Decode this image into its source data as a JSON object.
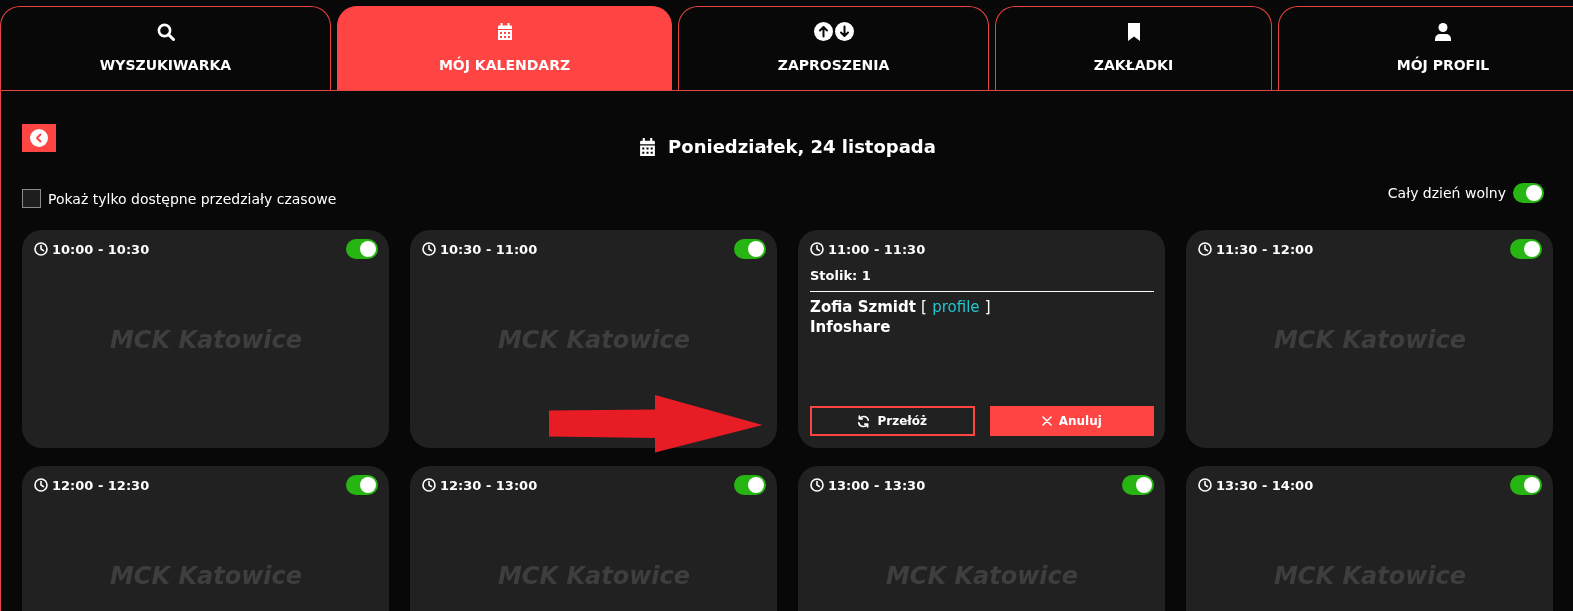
{
  "tabs": [
    {
      "label": "WYSZUKIWARKA",
      "selected": false
    },
    {
      "label": "MÓJ KALENDARZ",
      "selected": true
    },
    {
      "label": "ZAPROSZENIA",
      "selected": false
    },
    {
      "label": "ZAKŁADKI",
      "selected": false
    },
    {
      "label": "MÓJ PROFIL",
      "selected": false
    }
  ],
  "header": {
    "title": "Poniedziałek, 24 listopada"
  },
  "filter": {
    "label": "Pokaż tylko dostępne przedziały czasowe",
    "checked": false
  },
  "day_off": {
    "label": "Cały dzień wolny",
    "on": true
  },
  "slots": [
    {
      "kind": "free",
      "time": "10:00 - 10:30",
      "on": true,
      "venue": "MCK Katowice"
    },
    {
      "kind": "free",
      "time": "10:30 - 11:00",
      "on": true,
      "venue": "MCK Katowice"
    },
    {
      "kind": "booked",
      "time": "11:00 - 11:30",
      "table": "Stolik: 1",
      "guest": "Zofia Szmidt",
      "link_open": "[",
      "link": "profile",
      "link_close": "]",
      "company": "Infoshare",
      "buttons": [
        {
          "kind": "reschedule",
          "label": "Przełóż"
        },
        {
          "kind": "cancel",
          "label": "Anuluj"
        }
      ]
    },
    {
      "kind": "free",
      "time": "11:30 - 12:00",
      "on": true,
      "venue": "MCK Katowice"
    },
    {
      "kind": "free",
      "time": "12:00 - 12:30",
      "on": true,
      "venue": "MCK Katowice"
    },
    {
      "kind": "free",
      "time": "12:30 - 13:00",
      "on": true,
      "venue": "MCK Katowice"
    },
    {
      "kind": "free",
      "time": "13:00 - 13:30",
      "on": true,
      "venue": "MCK Katowice"
    },
    {
      "kind": "free",
      "time": "13:30 - 14:00",
      "on": true,
      "venue": "MCK Katowice"
    }
  ]
}
